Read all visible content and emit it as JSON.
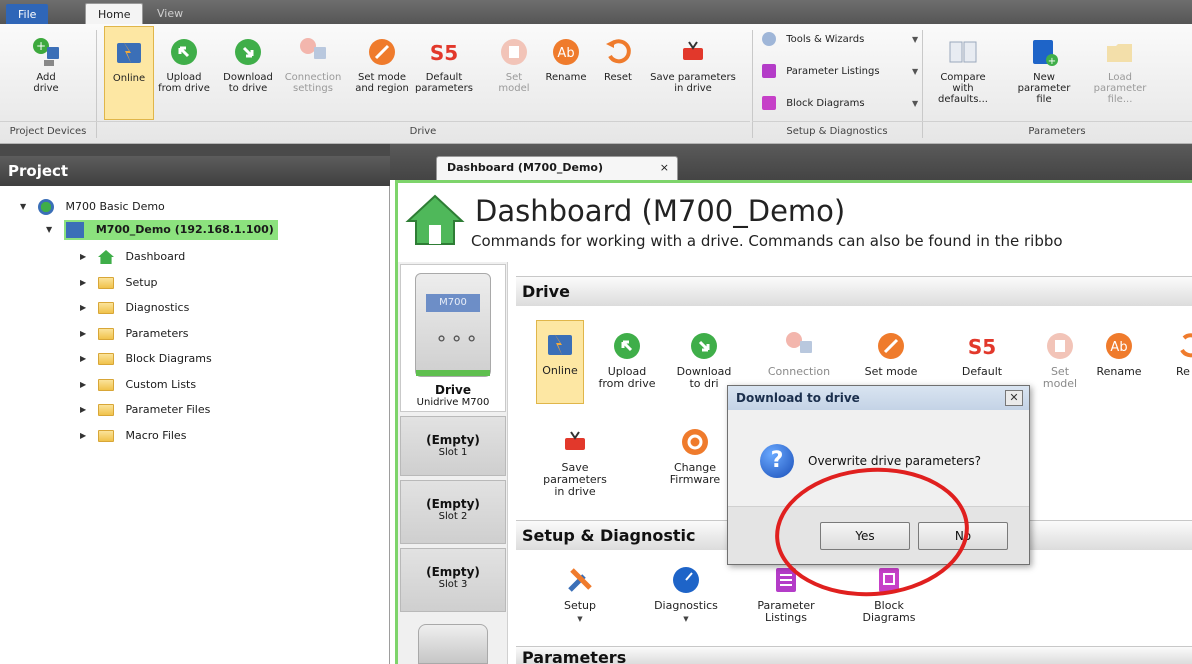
{
  "ribbon": {
    "tabs": {
      "file": "File",
      "home": "Home",
      "view": "View"
    },
    "project_devices": {
      "add_drive": "Add\ndrive",
      "group_label": "Project Devices"
    },
    "drive_group": {
      "group_label": "Drive",
      "buttons": {
        "online": "Online",
        "upload": "Upload\nfrom drive",
        "download": "Download\nto drive",
        "connection": "Connection\nsettings",
        "set_mode": "Set mode\nand region",
        "default": "Default\nparameters",
        "set_model": "Set\nmodel",
        "rename": "Rename",
        "reset": "Reset",
        "save_params": "Save parameters\nin drive"
      }
    },
    "setup_group": {
      "group_label": "Setup & Diagnostics",
      "tools": "Tools & Wizards",
      "param_listings": "Parameter Listings",
      "block_diagrams": "Block Diagrams"
    },
    "parameters_group": {
      "group_label": "Parameters",
      "compare": "Compare with\ndefaults...",
      "new_param": "New\nparameter file",
      "load_param": "Load\nparameter file..."
    }
  },
  "project": {
    "title": "Project",
    "root": "M700 Basic Demo",
    "drive": "M700_Demo (192.168.1.100)",
    "items": [
      "Dashboard",
      "Setup",
      "Diagnostics",
      "Parameters",
      "Block Diagrams",
      "Custom Lists",
      "Parameter Files",
      "Macro Files"
    ]
  },
  "document": {
    "tab_label": "Dashboard (M700_Demo)",
    "tab_close": "×",
    "title": "Dashboard (M700_Demo)",
    "subtitle": "Commands for working with a drive. Commands can also be found in the ribbo"
  },
  "slots": {
    "drive_badge": "M700",
    "drive_name": "Drive",
    "drive_model": "Unidrive M700",
    "empty": [
      {
        "name": "(Empty)",
        "slot": "Slot 1"
      },
      {
        "name": "(Empty)",
        "slot": "Slot 2"
      },
      {
        "name": "(Empty)",
        "slot": "Slot 3"
      }
    ]
  },
  "sections": {
    "drive": "Drive",
    "setup": "Setup & Diagnostic",
    "parameters": "Parameters"
  },
  "drive_buttons": {
    "online": "Online",
    "upload": "Upload\nfrom drive",
    "download": "Download\nto dri",
    "connection": "Connection",
    "set_mode": "Set mode",
    "default": "Default",
    "set_model": "Set\nmodel",
    "rename": "Rename",
    "reset": "Re",
    "save_params": "Save parameters\nin drive",
    "change_fw": "Change\nFirmware"
  },
  "setup_buttons": {
    "setup": "Setup",
    "diagnostics": "Diagnostics",
    "param_listings": "Parameter\nListings",
    "block_diagrams": "Block\nDiagrams"
  },
  "dialog": {
    "title": "Download to drive",
    "close": "✕",
    "message": "Overwrite drive parameters?",
    "yes": "Yes",
    "no": "No"
  },
  "colors": {
    "accent_green": "#7ed46b",
    "highlight_green": "#8ce27e",
    "selected_yellow": "#fde7a3",
    "file_blue": "#2f66b8",
    "annotation_red": "#e0201f"
  }
}
